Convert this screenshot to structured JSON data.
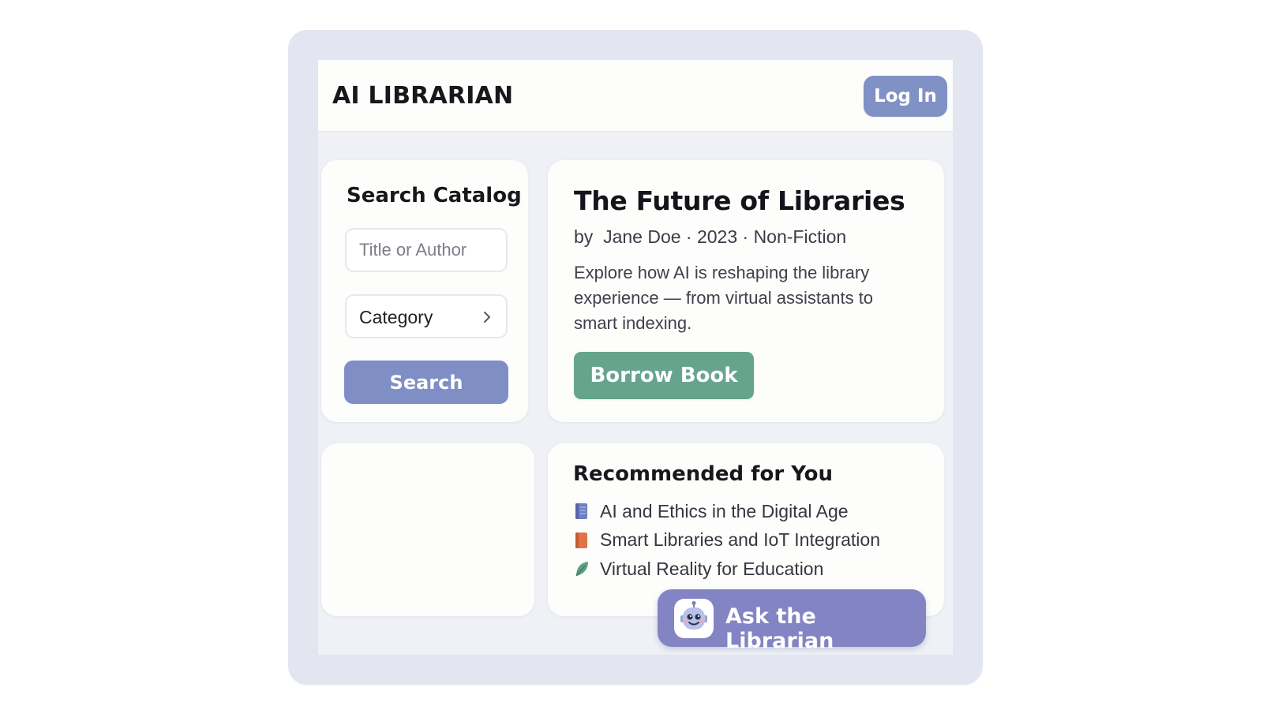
{
  "header": {
    "brand": "AI LIBRARIAN",
    "login_label": "Log In"
  },
  "search": {
    "title": "Search Catalog",
    "placeholder": "Title or Author",
    "category_label": "Category",
    "button_label": "Search"
  },
  "featured": {
    "title": "The Future of Libraries",
    "meta": "by  Jane Doe · 2023 · Non-Fiction",
    "description": "Explore how AI is reshaping the library experience — from virtual assistants to smart indexing.",
    "borrow_label": "Borrow Book"
  },
  "recommended": {
    "title": "Recommended for You",
    "items": [
      {
        "label": "AI and Ethics in the Digital Age",
        "icon": "book-blue-icon"
      },
      {
        "label": "Smart Libraries and IoT Integration",
        "icon": "book-orange-icon"
      },
      {
        "label": "Virtual Reality for Education",
        "icon": "leaf-icon"
      }
    ]
  },
  "assistant": {
    "label": "Ask the Librarian",
    "icon": "robot-icon"
  },
  "colors": {
    "accent": "#8091c5",
    "success": "#67a48e",
    "assistant": "#8384c4",
    "frame": "#e3e6f0",
    "background": "#eff1f7"
  }
}
